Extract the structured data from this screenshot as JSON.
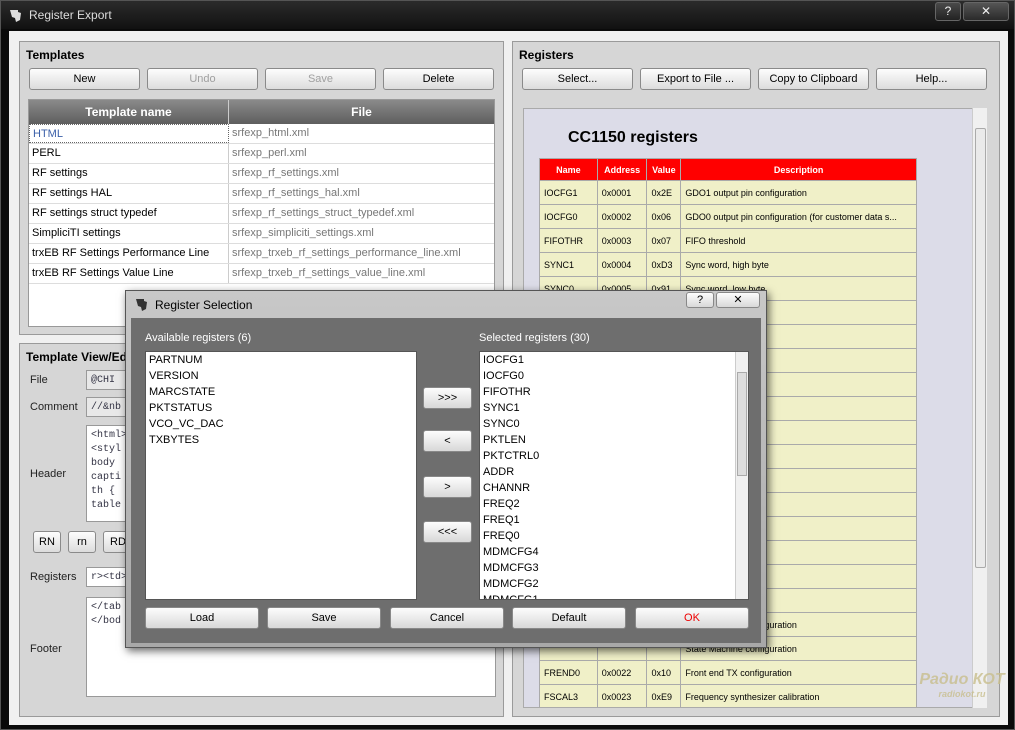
{
  "window": {
    "title": "Register Export",
    "help_label": "?",
    "close_label": "✕"
  },
  "templates": {
    "title": "Templates",
    "new_label": "New",
    "undo_label": "Undo",
    "save_label": "Save",
    "delete_label": "Delete",
    "col_name": "Template name",
    "col_file": "File",
    "rows": [
      [
        "HTML",
        "srfexp_html.xml"
      ],
      [
        "PERL",
        "srfexp_perl.xml"
      ],
      [
        "RF settings",
        "srfexp_rf_settings.xml"
      ],
      [
        "RF settings HAL",
        "srfexp_rf_settings_hal.xml"
      ],
      [
        "RF settings struct typedef",
        "srfexp_rf_settings_struct_typedef.xml"
      ],
      [
        "SimpliciTI settings",
        "srfexp_simpliciti_settings.xml"
      ],
      [
        "trxEB RF Settings Performance Line",
        "srfexp_trxeb_rf_settings_performance_line.xml"
      ],
      [
        "trxEB RF Settings Value Line",
        "srfexp_trxeb_rf_settings_value_line.xml"
      ]
    ]
  },
  "view": {
    "title": "Template View/Ed",
    "file_label": "File",
    "file_value": "@CHI",
    "comment_label": "Comment",
    "comment_value": "//&nb",
    "header_label": "Header",
    "header_value": "<html>\n<styl\nbody \ncapti\nth {\ntable",
    "btn_rn_upper": "RN",
    "btn_rn": "rn",
    "btn_rd": "RD",
    "registers_label": "Registers",
    "registers_value": "r><td>",
    "footer_label": "Footer",
    "footer_value": "</tab\n</bod"
  },
  "registers": {
    "title": "Registers",
    "select_label": "Select...",
    "export_label": "Export to File ...",
    "copy_label": "Copy to Clipboard",
    "help_label": "Help...",
    "heading": "CC1150 registers",
    "cols": [
      "Name",
      "Address",
      "Value",
      "Description"
    ],
    "rows": [
      [
        "IOCFG1",
        "0x0001",
        "0x2E",
        "GDO1 output pin configuration"
      ],
      [
        "IOCFG0",
        "0x0002",
        "0x06",
        "GDO0 output pin configuration (for customer data s..."
      ],
      [
        "FIFOTHR",
        "0x0003",
        "0x07",
        "FIFO threshold"
      ],
      [
        "SYNC1",
        "0x0004",
        "0xD3",
        "Sync word, high byte"
      ],
      [
        "SYNC0",
        "0x0005",
        "0x91",
        "Sync word, low byte"
      ],
      [
        "PKTLEN",
        "0x0006",
        "0xFF",
        ""
      ],
      [
        "",
        "",
        "",
        "control"
      ],
      [
        "",
        "",
        "",
        ""
      ],
      [
        "",
        "",
        "",
        ""
      ],
      [
        "",
        "",
        "",
        "word, high byte"
      ],
      [
        "",
        "",
        "",
        "word, middle byte"
      ],
      [
        "",
        "",
        "",
        "word, low byte"
      ],
      [
        "",
        "",
        "",
        "ration"
      ],
      [
        "",
        "",
        "",
        "ration"
      ],
      [
        "",
        "",
        "",
        "ration"
      ],
      [
        "",
        "",
        "",
        "ration"
      ],
      [
        "",
        "",
        "",
        "ration"
      ],
      [
        "",
        "",
        "",
        "setting"
      ],
      [
        "",
        "",
        "",
        "State Machine configuration"
      ],
      [
        "",
        "",
        "",
        "State Machine configuration"
      ],
      [
        "FREND0",
        "0x0022",
        "0x10",
        "Front end TX configuration"
      ],
      [
        "FSCAL3",
        "0x0023",
        "0xE9",
        "Frequency synthesizer calibration"
      ]
    ]
  },
  "dialog": {
    "title": "Register Selection",
    "available_label": "Available registers (6)",
    "selected_label": "Selected registers (30)",
    "available": [
      "PARTNUM",
      "VERSION",
      "MARCSTATE",
      "PKTSTATUS",
      "VCO_VC_DAC",
      "TXBYTES"
    ],
    "selected": [
      "IOCFG1",
      "IOCFG0",
      "FIFOTHR",
      "SYNC1",
      "SYNC0",
      "PKTLEN",
      "PKTCTRL0",
      "ADDR",
      "CHANNR",
      "FREQ2",
      "FREQ1",
      "FREQ0",
      "MDMCFG4",
      "MDMCFG3",
      "MDMCFG2",
      "MDMCFG1"
    ],
    "add_all": ">>>",
    "add": "<",
    "remove": ">",
    "remove_all": "<<<",
    "load": "Load",
    "save": "Save",
    "cancel": "Cancel",
    "default": "Default",
    "ok": "OK"
  },
  "watermark": {
    "line1": "Радио КОТ",
    "line2": "radiokot.ru"
  }
}
